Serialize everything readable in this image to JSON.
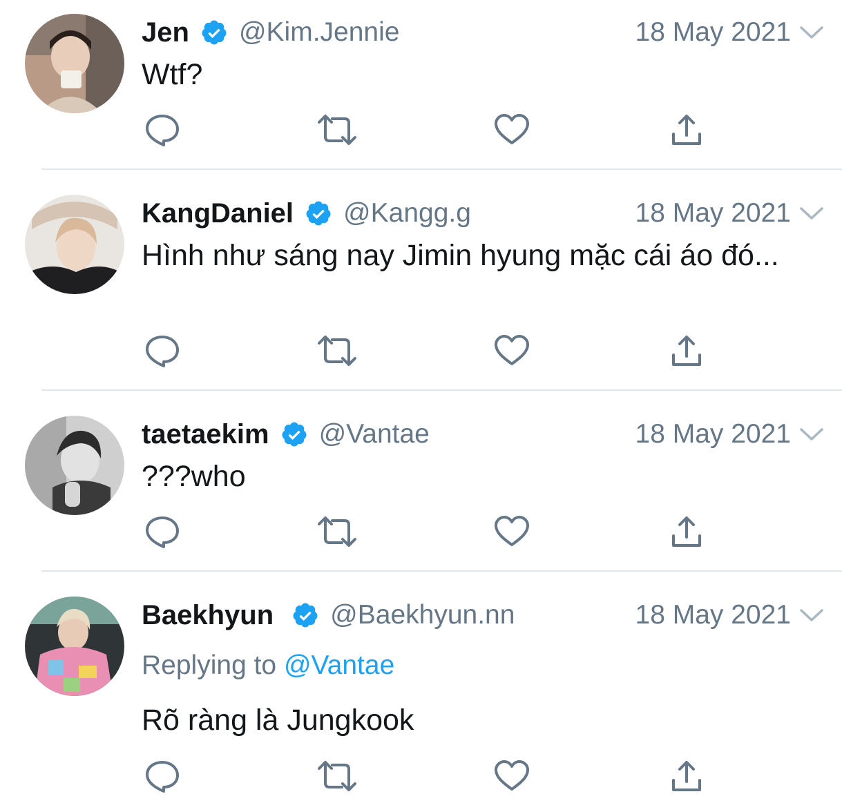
{
  "colors": {
    "text": "#14171a",
    "secondary": "#657786",
    "accent": "#1da1f2",
    "verified": "#1da1f2",
    "icon": "#657786",
    "divider": "#e1e8ed"
  },
  "icons": {
    "verified": "verified-badge-icon",
    "more": "chevron-down-icon",
    "reply": "reply-icon",
    "retweet": "retweet-icon",
    "like": "heart-icon",
    "share": "share-icon"
  },
  "tweets": [
    {
      "name": "Jen",
      "handle": "@Kim.Jennie",
      "date": "18 May 2021",
      "text": "Wtf?"
    },
    {
      "name": "KangDaniel",
      "handle": "@Kangg.g",
      "date": "18 May 2021",
      "text": "Hình như sáng nay Jimin hyung mặc cái áo đó..."
    },
    {
      "name": "taetaekim",
      "handle": "@Vantae",
      "date": "18 May 2021",
      "text": "???who"
    },
    {
      "name": "Baekhyun",
      "handle": "@Baekhyun.nn",
      "date": "18 May 2021",
      "replying_prefix": "Replying to",
      "replying_mention": "@Vantae",
      "text": "Rõ ràng là Jungkook"
    }
  ]
}
